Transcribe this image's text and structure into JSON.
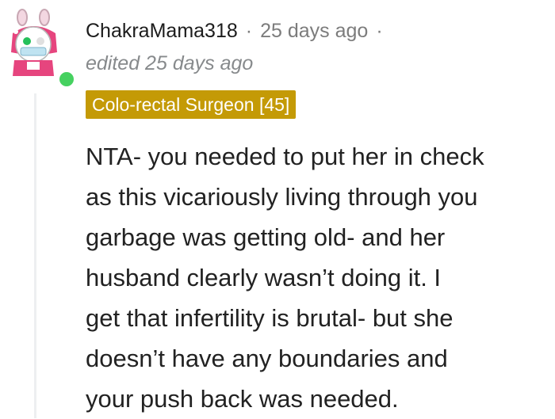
{
  "comment": {
    "username": "ChakraMama318",
    "timestamp": "25 days ago",
    "separator": "·",
    "edited": "edited 25 days ago",
    "flair": "Colo-rectal Surgeon [45]",
    "flair_color": "#c49a06",
    "online_color": "#46d160",
    "body_lines": [
      "NTA- you needed to put her in check",
      "as this vicariously living through you",
      "garbage was getting old- and her",
      "husband clearly wasn’t doing it. I",
      "get that infertility is brutal- but she",
      "doesn’t have any boundaries and",
      "your push back was needed."
    ]
  }
}
